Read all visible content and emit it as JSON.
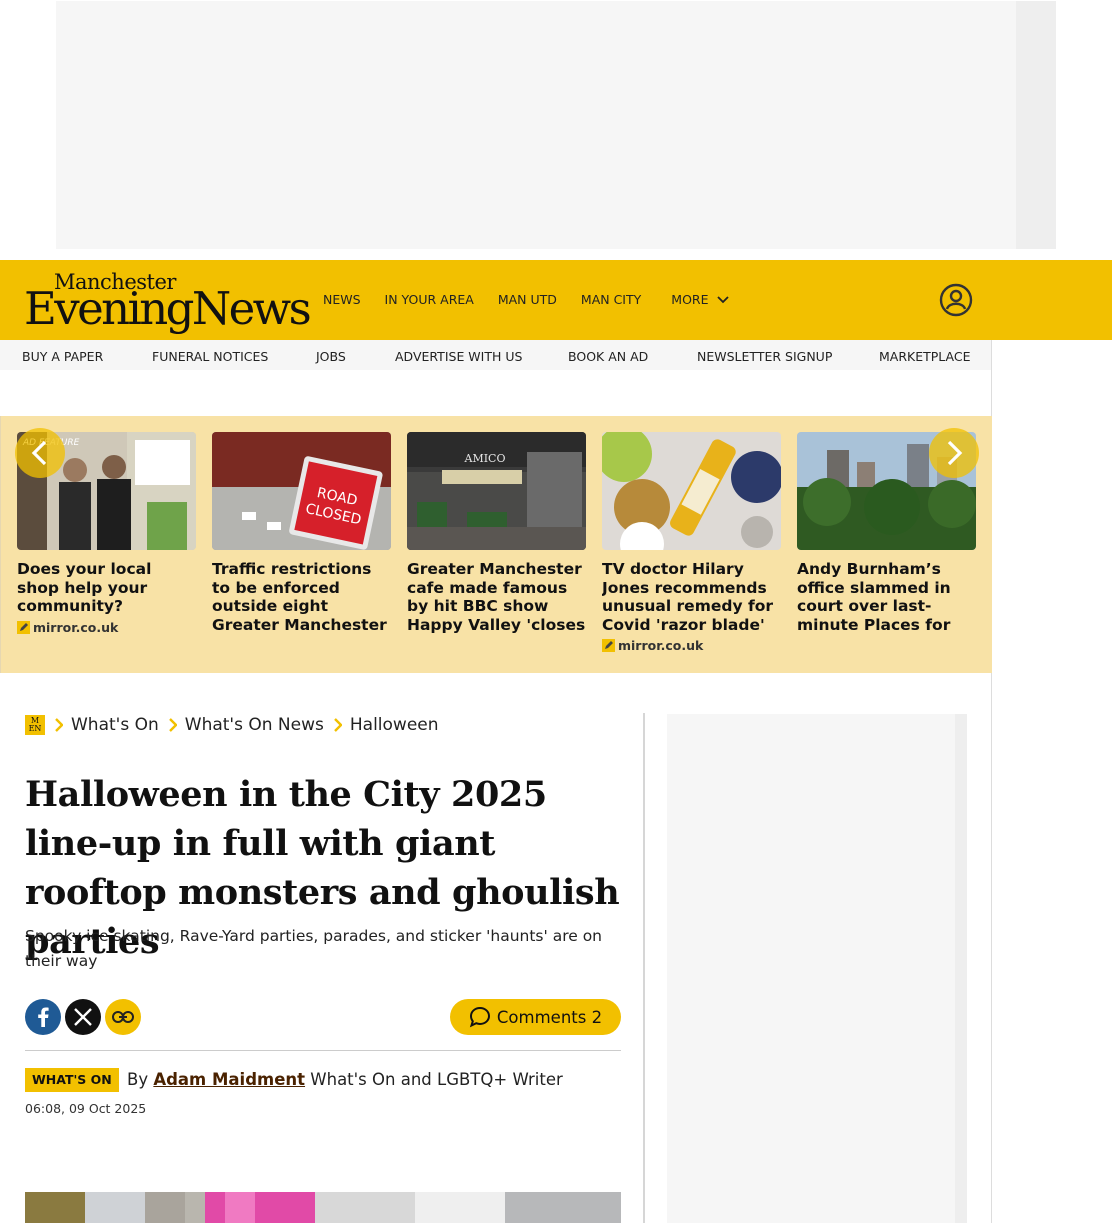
{
  "brand": {
    "logo_line1": "Manchester",
    "logo_line2": "EveningNews",
    "home_line1": "M",
    "home_line2": "EN",
    "color": "#f2c000"
  },
  "main_nav": {
    "items": [
      "NEWS",
      "IN YOUR AREA",
      "MAN UTD",
      "MAN CITY"
    ],
    "more_label": "MORE"
  },
  "sub_nav": {
    "items": [
      "BUY A PAPER",
      "FUNERAL NOTICES",
      "JOBS",
      "ADVERTISE WITH US",
      "BOOK AN AD",
      "NEWSLETTER SIGNUP",
      "MARKETPLACE"
    ]
  },
  "carousel": {
    "cards": [
      {
        "headline": "Does your local shop help your community?",
        "badge": "AD FEATURE",
        "source": "mirror.co.uk",
        "icon": "sponsored-icon"
      },
      {
        "headline": "Traffic restrictions to be enforced outside eight Greater Manchester primary schools",
        "badge": "",
        "source": "",
        "icon": ""
      },
      {
        "headline": "Greater Manchester cafe made famous by hit BBC show Happy Valley 'closes down'",
        "badge": "",
        "source": "",
        "icon": ""
      },
      {
        "headline": "TV doctor Hilary Jones recommends unusual remedy for Covid 'razor blade' sore throat",
        "badge": "",
        "source": "mirror.co.uk",
        "icon": "sponsored-icon"
      },
      {
        "headline": "Andy Burnham’s office slammed in court over last-minute Places for Everyone green belt changes",
        "badge": "",
        "source": "",
        "icon": ""
      }
    ]
  },
  "breadcrumb": {
    "items": [
      "What's On",
      "What's On News",
      "Halloween"
    ]
  },
  "article": {
    "title": "Halloween in the City 2025 line-up in full with giant rooftop monsters and ghoulish parties",
    "standfirst": "Spooky ice skating, Rave-Yard parties, parades, and sticker 'haunts' are on their way",
    "comments_label": "Comments",
    "comments_count": "2",
    "tag": "WHAT'S ON",
    "by": "By",
    "author": "Adam Maidment",
    "author_role": "What's On and LGBTQ+ Writer",
    "date": "06:08, 09 Oct 2025"
  },
  "share": {
    "icons": [
      "facebook-icon",
      "x-icon",
      "copy-link-icon"
    ],
    "colors": {
      "facebook": "#1f5a95",
      "x": "#111111",
      "link": "#f2c000"
    }
  }
}
